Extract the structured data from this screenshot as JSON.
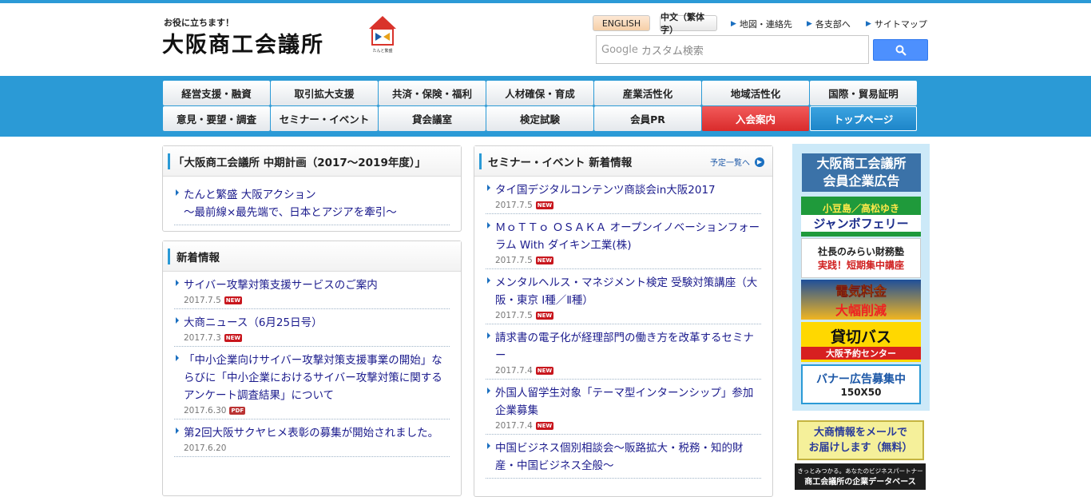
{
  "header": {
    "tagline": "お役に立ちます！",
    "logo_text": "大阪商工会議所",
    "logo_sub": "たんと繁盛",
    "lang_english": "ENGLISH",
    "lang_chinese": "中文（繁体字）",
    "util_links": [
      "地図・連絡先",
      "各支部へ",
      "サイトマップ"
    ],
    "search_placeholder": "カスタム検索",
    "search_brand": "Google"
  },
  "nav": {
    "row1": [
      "経営支援・融資",
      "取引拡大支援",
      "共済・保険・福利",
      "人材確保・育成",
      "産業活性化",
      "地域活性化",
      "国際・貿易証明"
    ],
    "row2": [
      "意見・要望・調査",
      "セミナー・イベント",
      "貸会議室",
      "検定試験",
      "会員PR",
      "入会案内",
      "トップページ"
    ]
  },
  "plan": {
    "title": "「大阪商工会議所 中期計画（2017〜2019年度）」",
    "item_line1": "たんと繁盛 大阪アクション",
    "item_line2": "〜最前線×最先端で、日本とアジアを牽引〜"
  },
  "news": {
    "title": "新着情報",
    "items": [
      {
        "text": "サイバー攻撃対策支援サービスのご案内",
        "date": "2017.7.5",
        "badge": "NEW"
      },
      {
        "text": "大商ニュース（6月25日号）",
        "date": "2017.7.3",
        "badge": "NEW"
      },
      {
        "text": "「中小企業向けサイバー攻撃対策支援事業の開始」ならびに「中小企業におけるサイバー攻撃対策に関するアンケート調査結果」について",
        "date": "2017.6.30",
        "badge": "PDF"
      },
      {
        "text": "第2回大阪サクヤヒメ表彰の募集が開始されました。",
        "date": "2017.6.20",
        "badge": ""
      }
    ]
  },
  "seminar": {
    "title": "セミナー・イベント 新着情報",
    "more": "予定一覧へ",
    "items": [
      {
        "text": "タイ国デジタルコンテンツ商談会in大阪2017",
        "date": "2017.7.5",
        "badge": "NEW"
      },
      {
        "text": "ＭｏＴＴｏ ＯＳＡＫＡ オープンイノベーションフォーラム With ダイキン工業(株)",
        "date": "2017.7.5",
        "badge": "NEW"
      },
      {
        "text": "メンタルヘルス・マネジメント検定 受験対策講座（大阪・東京 Ⅰ種／Ⅱ種）",
        "date": "2017.7.5",
        "badge": "NEW"
      },
      {
        "text": "請求書の電子化が経理部門の働き方を改革するセミナー",
        "date": "2017.7.4",
        "badge": "NEW"
      },
      {
        "text": "外国人留学生対象「テーマ型インターンシップ」参加企業募集",
        "date": "2017.7.4",
        "badge": "NEW"
      },
      {
        "text": "中国ビジネス個別相談会〜販路拡大・税務・知的財産・中国ビジネス全般〜",
        "date": "",
        "badge": ""
      }
    ]
  },
  "ads": {
    "head": "大阪商工会議所\n会員企業広告",
    "ferry": [
      "小豆島／高松ゆき",
      "ジャンボフェリー"
    ],
    "zaimu": [
      "社長のみらい財務塾",
      "実践！短期集中講座"
    ],
    "denki": [
      "電気料金",
      "大幅削減"
    ],
    "bus": [
      "貸切バス",
      "大阪予約センター"
    ],
    "banner": [
      "バナー広告募集中",
      "150X50"
    ],
    "mail": [
      "大商情報をメールで",
      "お届けします（無料）"
    ],
    "db": [
      "きっとみつかる。あなたのビジネスパートナー",
      "商工会議所の企業データベース"
    ]
  },
  "colors": {
    "accent": "#2b9ad6",
    "join": "#d92b2b",
    "link": "#1a1a8c"
  }
}
